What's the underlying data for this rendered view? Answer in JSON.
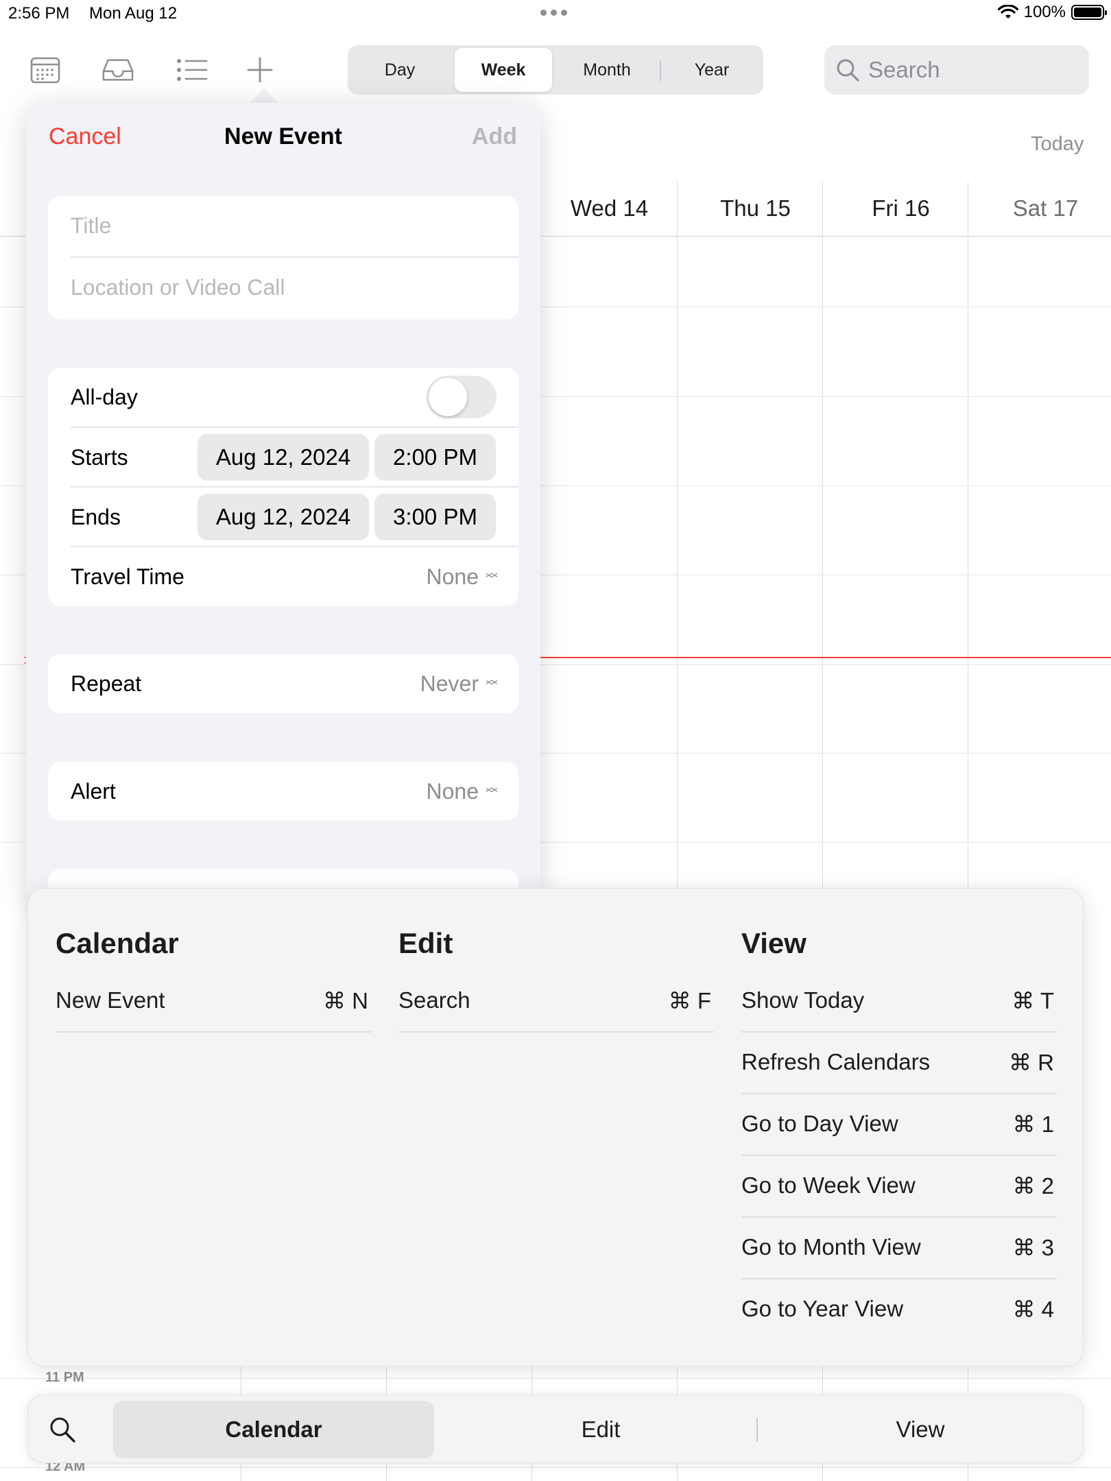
{
  "status_bar": {
    "time": "2:56 PM",
    "date": "Mon Aug 12",
    "battery": "100%"
  },
  "toolbar": {
    "view_tabs": [
      {
        "label": "Day",
        "active": false
      },
      {
        "label": "Week",
        "active": true
      },
      {
        "label": "Month",
        "active": false
      },
      {
        "label": "Year",
        "active": false
      }
    ],
    "search_placeholder": "Search",
    "icons": [
      "calendar-icon",
      "inbox-icon",
      "list-icon",
      "add-icon"
    ]
  },
  "calendar": {
    "today_button": "Today",
    "days": [
      "Wed 14",
      "Thu 15",
      "Fri 16",
      "Sat 17"
    ],
    "hour_labels": [
      "11 PM",
      "12 AM"
    ],
    "accent_color": "#ff3b30"
  },
  "new_event": {
    "cancel": "Cancel",
    "title": "New Event",
    "add": "Add",
    "title_placeholder": "Title",
    "location_placeholder": "Location or Video Call",
    "all_day_label": "All-day",
    "all_day_on": false,
    "starts_label": "Starts",
    "starts_date": "Aug 12, 2024",
    "starts_time": "2:00 PM",
    "ends_label": "Ends",
    "ends_date": "Aug 12, 2024",
    "ends_time": "3:00 PM",
    "travel_label": "Travel Time",
    "travel_value": "None",
    "repeat_label": "Repeat",
    "repeat_value": "Never",
    "alert_label": "Alert",
    "alert_value": "None"
  },
  "shortcuts": {
    "calendar": {
      "heading": "Calendar",
      "items": [
        {
          "label": "New Event",
          "key": "⌘ N"
        }
      ]
    },
    "edit": {
      "heading": "Edit",
      "items": [
        {
          "label": "Search",
          "key": "⌘ F"
        }
      ]
    },
    "view": {
      "heading": "View",
      "items": [
        {
          "label": "Show Today",
          "key": "⌘ T"
        },
        {
          "label": "Refresh Calendars",
          "key": "⌘ R"
        },
        {
          "label": "Go to Day View",
          "key": "⌘ 1"
        },
        {
          "label": "Go to Week View",
          "key": "⌘ 2"
        },
        {
          "label": "Go to Month View",
          "key": "⌘ 3"
        },
        {
          "label": "Go to Year View",
          "key": "⌘ 4"
        }
      ]
    }
  },
  "bottom_bar": {
    "tabs": [
      {
        "label": "Calendar",
        "active": true
      },
      {
        "label": "Edit",
        "active": false
      },
      {
        "label": "View",
        "active": false
      }
    ]
  }
}
